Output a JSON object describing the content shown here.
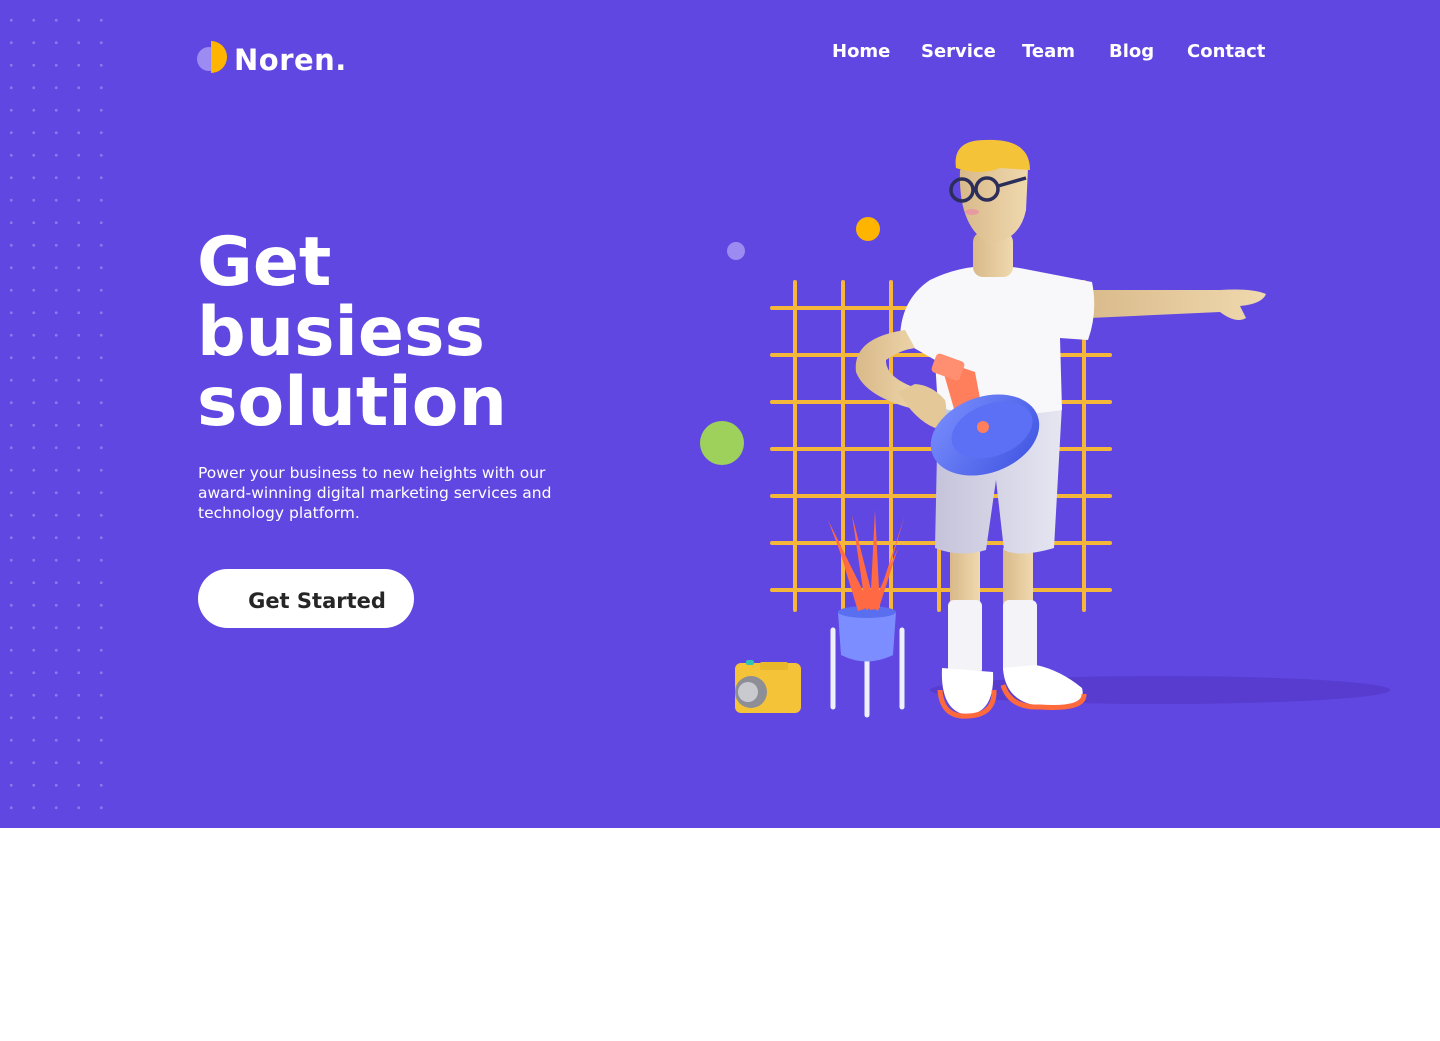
{
  "brand": {
    "name": "Noren.",
    "colors": {
      "background": "#6147e2",
      "accent_yellow": "#ffb400",
      "accent_lilac": "#9c8bf0",
      "accent_green": "#9dd15c"
    }
  },
  "nav": {
    "items": [
      {
        "label": "Home"
      },
      {
        "label": "Service"
      },
      {
        "label": "Team"
      },
      {
        "label": "Blog"
      },
      {
        "label": "Contact"
      }
    ]
  },
  "hero": {
    "headline_lines": [
      "Get",
      "busiess",
      "solution"
    ],
    "subtext": "Power your business to new heights with our award-winning digital marketing services and technology platform.",
    "cta_label": "Get Started"
  },
  "illustration": {
    "subject": "3d-man-with-megaphone",
    "props": [
      "grid-frame",
      "potted-plant",
      "camera",
      "decorative-circles"
    ]
  }
}
